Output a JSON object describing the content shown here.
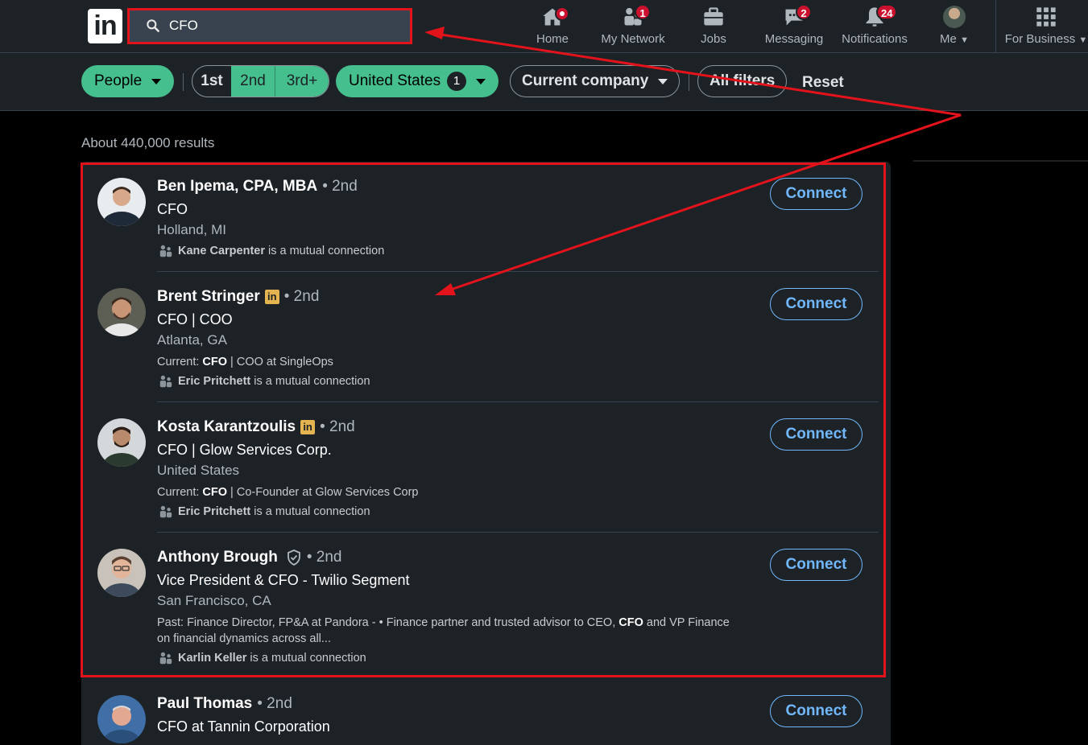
{
  "nav": {
    "logo": "in",
    "search_value": "CFO",
    "items": [
      {
        "label": "Home",
        "badge": ""
      },
      {
        "label": "My Network",
        "badge": "1"
      },
      {
        "label": "Jobs",
        "badge": ""
      },
      {
        "label": "Messaging",
        "badge": "2"
      },
      {
        "label": "Notifications",
        "badge": "24"
      },
      {
        "label": "Me",
        "badge": ""
      },
      {
        "label": "For Business",
        "badge": ""
      }
    ]
  },
  "filters": {
    "people": "People",
    "deg1": "1st",
    "deg2": "2nd",
    "deg3": "3rd+",
    "location": "United States",
    "location_count": "1",
    "company": "Current company",
    "all": "All filters",
    "reset": "Reset"
  },
  "results": {
    "count_text": "About 440,000 results",
    "connect_label": "Connect",
    "mutual_suffix": "is a mutual connection",
    "people": [
      {
        "name": "Ben Ipema, CPA, MBA",
        "degree": "• 2nd",
        "headline": "CFO",
        "location": "Holland, MI",
        "mutual": "Kane Carpenter"
      },
      {
        "name": "Brent Stringer",
        "degree": "• 2nd",
        "headline": "CFO | COO",
        "location": "Atlanta, GA",
        "snippet_prefix": "Current: ",
        "snippet_bold": "CFO",
        "snippet_rest": " | COO at SingleOps",
        "mutual": "Eric Pritchett"
      },
      {
        "name": "Kosta Karantzoulis",
        "degree": "• 2nd",
        "headline": "CFO | Glow Services Corp.",
        "location": "United States",
        "snippet_prefix": "Current: ",
        "snippet_bold": "CFO",
        "snippet_rest": " | Co-Founder at Glow Services Corp",
        "mutual": "Eric Pritchett"
      },
      {
        "name": "Anthony Brough",
        "degree": "• 2nd",
        "headline": "Vice President & CFO - Twilio Segment",
        "location": "San Francisco, CA",
        "snippet_prefix": "Past: Finance Director, FP&A at Pandora - • Finance partner and trusted advisor to CEO, ",
        "snippet_bold": "CFO",
        "snippet_rest": " and VP Finance on financial dynamics across all...",
        "mutual": "Karlin Keller"
      },
      {
        "name": "Paul Thomas",
        "degree": "• 2nd",
        "headline": "CFO at Tannin Corporation"
      }
    ]
  },
  "colors": {
    "accent_green": "#44bf8d",
    "link_blue": "#71b7fb",
    "annotation_red": "#e3131b",
    "badge_red": "#cb112d",
    "premium_gold": "#e3b450"
  }
}
